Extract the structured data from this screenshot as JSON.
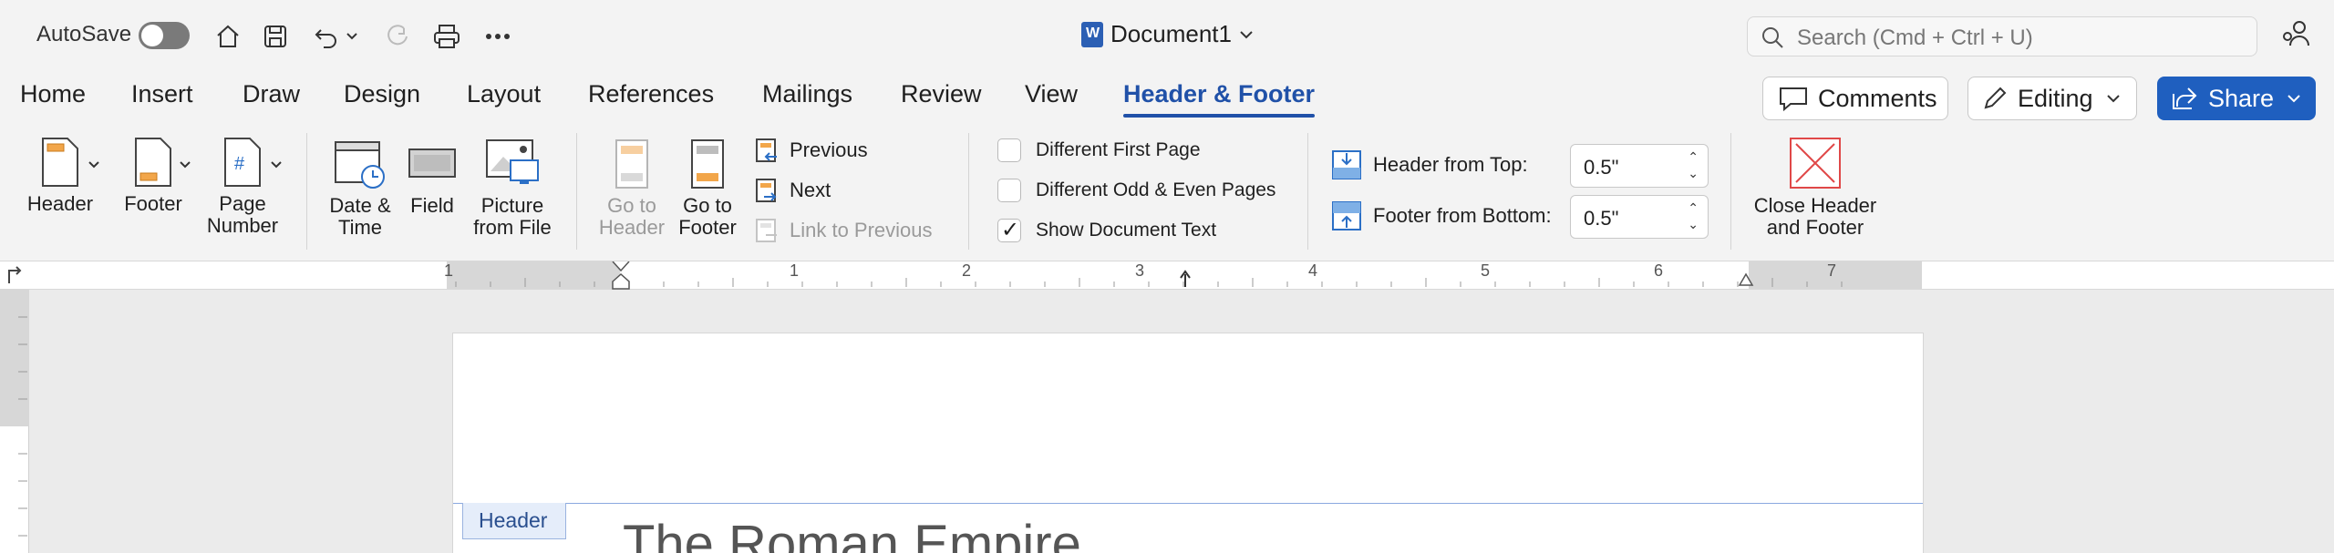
{
  "titlebar": {
    "autosave_label": "AutoSave",
    "document_title": "Document1",
    "search_placeholder": "Search (Cmd + Ctrl + U)"
  },
  "tabs": [
    "Home",
    "Insert",
    "Draw",
    "Design",
    "Layout",
    "References",
    "Mailings",
    "Review",
    "View",
    "Header & Footer"
  ],
  "active_tab": "Header & Footer",
  "top_buttons": {
    "comments": "Comments",
    "editing": "Editing",
    "share": "Share"
  },
  "ribbon": {
    "header": "Header",
    "footer": "Footer",
    "page_number_1": "Page",
    "page_number_2": "Number",
    "date_time_1": "Date &",
    "date_time_2": "Time",
    "field": "Field",
    "picture_1": "Picture",
    "picture_2": "from File",
    "go_header_1": "Go to",
    "go_header_2": "Header",
    "go_footer_1": "Go to",
    "go_footer_2": "Footer",
    "previous": "Previous",
    "next": "Next",
    "link_previous": "Link to Previous",
    "different_first_page": "Different First Page",
    "different_odd_even": "Different Odd & Even Pages",
    "show_document_text": "Show Document Text",
    "header_from_top_label": "Header from Top:",
    "header_from_top_value": "0.5\"",
    "footer_from_bottom_label": "Footer from Bottom:",
    "footer_from_bottom_value": "0.5\"",
    "close_1": "Close Header",
    "close_2": "and Footer"
  },
  "checkboxes": {
    "different_first_page": false,
    "different_odd_even": false,
    "show_document_text": true
  },
  "ruler": {
    "numbers": [
      "1",
      "1",
      "2",
      "3",
      "4",
      "5",
      "6",
      "7"
    ]
  },
  "document": {
    "header_tag": "Header",
    "title_text": "The Roman Empire"
  },
  "colors": {
    "accent": "#2051a8",
    "share_button": "#1f5fbf",
    "close_icon": "#e04848",
    "header_icon_fill": "#f2a64a"
  }
}
